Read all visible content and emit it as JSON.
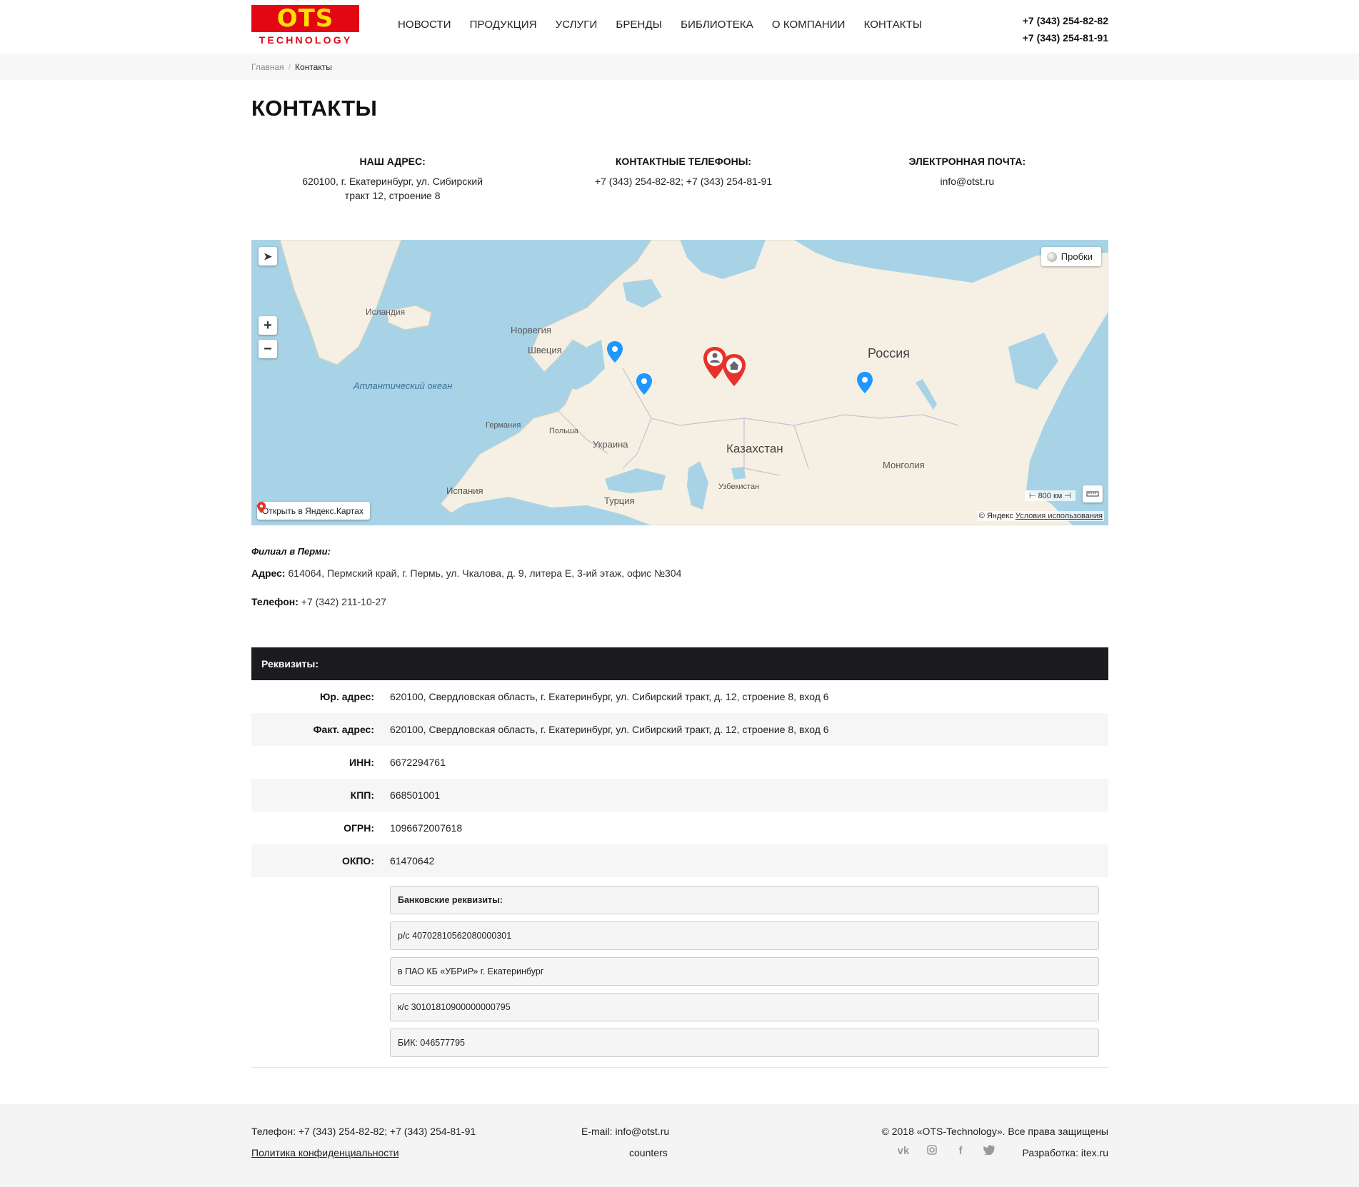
{
  "header": {
    "logo_main": "OTS",
    "logo_sub": "TECHNOLOGY",
    "nav": [
      "НОВОСТИ",
      "ПРОДУКЦИЯ",
      "УСЛУГИ",
      "БРЕНДЫ",
      "БИБЛИОТЕКА",
      "О КОМПАНИИ",
      "КОНТАКТЫ"
    ],
    "phone1": "+7 (343) 254-82-82",
    "phone2": "+7 (343) 254-81-91"
  },
  "breadcrumb": {
    "home": "Главная",
    "separator": "/",
    "current": "Контакты"
  },
  "page_title": "КОНТАКТЫ",
  "contacts": {
    "address_title": "НАШ АДРЕС:",
    "address": "620100, г. Екатеринбург, ул. Сибирский тракт 12, строение 8",
    "phones_title": "КОНТАКТНЫЕ ТЕЛЕФОНЫ:",
    "phones": "+7 (343) 254-82-82; +7 (343) 254-81-91",
    "email_title": "ЭЛЕКТРОННАЯ ПОЧТА:",
    "email": "info@otst.ru"
  },
  "map": {
    "labels": {
      "iceland": "Исландия",
      "norway": "Норвегия",
      "sweden": "Швеция",
      "ocean": "Атлантический океан",
      "russia": "Россия",
      "germany": "Германия",
      "poland": "Польша",
      "ukraine": "Украина",
      "kazakhstan": "Казахстан",
      "mongolia": "Монголия",
      "uzbekistan": "Узбекистан",
      "spain": "Испания",
      "turkey": "Турция"
    },
    "traffic_label": "Пробки",
    "open_label": "Открыть в Яндекс.Картах",
    "scale_label": "800 км",
    "copyright": "© Яндекс",
    "terms": "Условия использования",
    "marker_colors": {
      "blue": "#1e98ff",
      "red": "#e6332a"
    }
  },
  "branch": {
    "title": "Филиал в Перми:",
    "address_label": "Адрес:",
    "address": "614064, Пермский край, г. Пермь, ул. Чкалова, д. 9, литера Е, 3-ий этаж, офис №304",
    "phone_label": "Телефон:",
    "phone": "+7 (342) 211-10-27"
  },
  "requisites": {
    "title": "Реквизиты:",
    "rows": [
      {
        "k": "Юр. адрес:",
        "v": "620100, Свердловская область, г. Екатеринбург, ул. Сибирский тракт, д. 12, строение 8, вход 6"
      },
      {
        "k": "Факт. адрес:",
        "v": "620100, Свердловская область, г. Екатеринбург, ул. Сибирский тракт, д. 12, строение 8, вход 6"
      },
      {
        "k": "ИНН:",
        "v": "6672294761"
      },
      {
        "k": "КПП:",
        "v": "668501001"
      },
      {
        "k": "ОГРН:",
        "v": "1096672007618"
      },
      {
        "k": "ОКПО:",
        "v": "61470642"
      }
    ],
    "bank": [
      "Банковские реквизиты:",
      "р/с 40702810562080000301",
      "в ПАО КБ «УБРиР» г. Екатеринбург",
      "к/с 30101810900000000795",
      "БИК: 046577795"
    ]
  },
  "footer": {
    "phone": "Телефон: +7 (343) 254-82-82; +7 (343) 254-81-91",
    "privacy": "Политика конфиденциальности",
    "email": "E-mail: info@otst.ru",
    "counters": "counters",
    "copyright": "© 2018 «OTS-Technology». Все права защищены",
    "dev": "Разработка: itex.ru",
    "social_icons": [
      "vk-icon",
      "instagram-icon",
      "facebook-icon",
      "twitter-icon"
    ]
  }
}
